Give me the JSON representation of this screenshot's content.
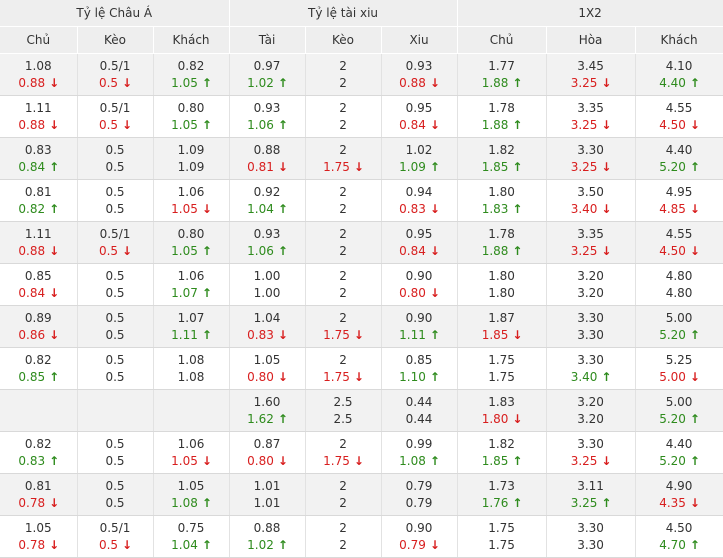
{
  "groups": [
    "Tỷ lệ Châu Á",
    "Tỷ lệ tài xiu",
    "1X2"
  ],
  "columns": [
    "Chủ",
    "Kèo",
    "Khách",
    "Tài",
    "Kèo",
    "Xiu",
    "Chủ",
    "Hòa",
    "Khách"
  ],
  "icons": {
    "up": "arrow-up-icon",
    "down": "arrow-down-icon"
  },
  "colors": {
    "up": "#2e8b1d",
    "down": "#d81e1e",
    "header_bg": "#eeeeee",
    "alt_row_bg": "#f2f2f2"
  },
  "arrow_glyphs": {
    "up": "↑",
    "down": "↓"
  },
  "rows": [
    [
      [
        {
          "v": "1.08"
        },
        {
          "v": "0.88",
          "t": "down"
        }
      ],
      [
        {
          "v": "0.5/1"
        },
        {
          "v": "0.5",
          "t": "down"
        }
      ],
      [
        {
          "v": "0.82"
        },
        {
          "v": "1.05",
          "t": "up"
        }
      ],
      [
        {
          "v": "0.97"
        },
        {
          "v": "1.02",
          "t": "up"
        }
      ],
      [
        {
          "v": "2"
        },
        {
          "v": "2"
        }
      ],
      [
        {
          "v": "0.93"
        },
        {
          "v": "0.88",
          "t": "down"
        }
      ],
      [
        {
          "v": "1.77"
        },
        {
          "v": "1.88",
          "t": "up"
        }
      ],
      [
        {
          "v": "3.45"
        },
        {
          "v": "3.25",
          "t": "down"
        }
      ],
      [
        {
          "v": "4.10"
        },
        {
          "v": "4.40",
          "t": "up"
        }
      ]
    ],
    [
      [
        {
          "v": "1.11"
        },
        {
          "v": "0.88",
          "t": "down"
        }
      ],
      [
        {
          "v": "0.5/1"
        },
        {
          "v": "0.5",
          "t": "down"
        }
      ],
      [
        {
          "v": "0.80"
        },
        {
          "v": "1.05",
          "t": "up"
        }
      ],
      [
        {
          "v": "0.93"
        },
        {
          "v": "1.06",
          "t": "up"
        }
      ],
      [
        {
          "v": "2"
        },
        {
          "v": "2"
        }
      ],
      [
        {
          "v": "0.95"
        },
        {
          "v": "0.84",
          "t": "down"
        }
      ],
      [
        {
          "v": "1.78"
        },
        {
          "v": "1.88",
          "t": "up"
        }
      ],
      [
        {
          "v": "3.35"
        },
        {
          "v": "3.25",
          "t": "down"
        }
      ],
      [
        {
          "v": "4.55"
        },
        {
          "v": "4.50",
          "t": "down"
        }
      ]
    ],
    [
      [
        {
          "v": "0.83"
        },
        {
          "v": "0.84",
          "t": "up"
        }
      ],
      [
        {
          "v": "0.5"
        },
        {
          "v": "0.5"
        }
      ],
      [
        {
          "v": "1.09"
        },
        {
          "v": "1.09"
        }
      ],
      [
        {
          "v": "0.88"
        },
        {
          "v": "0.81",
          "t": "down"
        }
      ],
      [
        {
          "v": "2"
        },
        {
          "v": "1.75",
          "t": "down"
        }
      ],
      [
        {
          "v": "1.02"
        },
        {
          "v": "1.09",
          "t": "up"
        }
      ],
      [
        {
          "v": "1.82"
        },
        {
          "v": "1.85",
          "t": "up"
        }
      ],
      [
        {
          "v": "3.30"
        },
        {
          "v": "3.25",
          "t": "down"
        }
      ],
      [
        {
          "v": "4.40"
        },
        {
          "v": "5.20",
          "t": "up"
        }
      ]
    ],
    [
      [
        {
          "v": "0.81"
        },
        {
          "v": "0.82",
          "t": "up"
        }
      ],
      [
        {
          "v": "0.5"
        },
        {
          "v": "0.5"
        }
      ],
      [
        {
          "v": "1.06"
        },
        {
          "v": "1.05",
          "t": "down"
        }
      ],
      [
        {
          "v": "0.92"
        },
        {
          "v": "1.04",
          "t": "up"
        }
      ],
      [
        {
          "v": "2"
        },
        {
          "v": "2"
        }
      ],
      [
        {
          "v": "0.94"
        },
        {
          "v": "0.83",
          "t": "down"
        }
      ],
      [
        {
          "v": "1.80"
        },
        {
          "v": "1.83",
          "t": "up"
        }
      ],
      [
        {
          "v": "3.50"
        },
        {
          "v": "3.40",
          "t": "down"
        }
      ],
      [
        {
          "v": "4.95"
        },
        {
          "v": "4.85",
          "t": "down"
        }
      ]
    ],
    [
      [
        {
          "v": "1.11"
        },
        {
          "v": "0.88",
          "t": "down"
        }
      ],
      [
        {
          "v": "0.5/1"
        },
        {
          "v": "0.5",
          "t": "down"
        }
      ],
      [
        {
          "v": "0.80"
        },
        {
          "v": "1.05",
          "t": "up"
        }
      ],
      [
        {
          "v": "0.93"
        },
        {
          "v": "1.06",
          "t": "up"
        }
      ],
      [
        {
          "v": "2"
        },
        {
          "v": "2"
        }
      ],
      [
        {
          "v": "0.95"
        },
        {
          "v": "0.84",
          "t": "down"
        }
      ],
      [
        {
          "v": "1.78"
        },
        {
          "v": "1.88",
          "t": "up"
        }
      ],
      [
        {
          "v": "3.35"
        },
        {
          "v": "3.25",
          "t": "down"
        }
      ],
      [
        {
          "v": "4.55"
        },
        {
          "v": "4.50",
          "t": "down"
        }
      ]
    ],
    [
      [
        {
          "v": "0.85"
        },
        {
          "v": "0.84",
          "t": "down"
        }
      ],
      [
        {
          "v": "0.5"
        },
        {
          "v": "0.5"
        }
      ],
      [
        {
          "v": "1.06"
        },
        {
          "v": "1.07",
          "t": "up"
        }
      ],
      [
        {
          "v": "1.00"
        },
        {
          "v": "1.00"
        }
      ],
      [
        {
          "v": "2"
        },
        {
          "v": "2"
        }
      ],
      [
        {
          "v": "0.90"
        },
        {
          "v": "0.80",
          "t": "down"
        }
      ],
      [
        {
          "v": "1.80"
        },
        {
          "v": "1.80"
        }
      ],
      [
        {
          "v": "3.20"
        },
        {
          "v": "3.20"
        }
      ],
      [
        {
          "v": "4.80"
        },
        {
          "v": "4.80"
        }
      ]
    ],
    [
      [
        {
          "v": "0.89"
        },
        {
          "v": "0.86",
          "t": "down"
        }
      ],
      [
        {
          "v": "0.5"
        },
        {
          "v": "0.5"
        }
      ],
      [
        {
          "v": "1.07"
        },
        {
          "v": "1.11",
          "t": "up"
        }
      ],
      [
        {
          "v": "1.04"
        },
        {
          "v": "0.83",
          "t": "down"
        }
      ],
      [
        {
          "v": "2"
        },
        {
          "v": "1.75",
          "t": "down"
        }
      ],
      [
        {
          "v": "0.90"
        },
        {
          "v": "1.11",
          "t": "up"
        }
      ],
      [
        {
          "v": "1.87"
        },
        {
          "v": "1.85",
          "t": "down"
        }
      ],
      [
        {
          "v": "3.30"
        },
        {
          "v": "3.30"
        }
      ],
      [
        {
          "v": "5.00"
        },
        {
          "v": "5.20",
          "t": "up"
        }
      ]
    ],
    [
      [
        {
          "v": "0.82"
        },
        {
          "v": "0.85",
          "t": "up"
        }
      ],
      [
        {
          "v": "0.5"
        },
        {
          "v": "0.5"
        }
      ],
      [
        {
          "v": "1.08"
        },
        {
          "v": "1.08"
        }
      ],
      [
        {
          "v": "1.05"
        },
        {
          "v": "0.80",
          "t": "down"
        }
      ],
      [
        {
          "v": "2"
        },
        {
          "v": "1.75",
          "t": "down"
        }
      ],
      [
        {
          "v": "0.85"
        },
        {
          "v": "1.10",
          "t": "up"
        }
      ],
      [
        {
          "v": "1.75"
        },
        {
          "v": "1.75"
        }
      ],
      [
        {
          "v": "3.30"
        },
        {
          "v": "3.40",
          "t": "up"
        }
      ],
      [
        {
          "v": "5.25"
        },
        {
          "v": "5.00",
          "t": "down"
        }
      ]
    ],
    [
      [],
      [],
      [],
      [
        {
          "v": "1.60"
        },
        {
          "v": "1.62",
          "t": "up"
        }
      ],
      [
        {
          "v": "2.5"
        },
        {
          "v": "2.5"
        }
      ],
      [
        {
          "v": "0.44"
        },
        {
          "v": "0.44"
        }
      ],
      [
        {
          "v": "1.83"
        },
        {
          "v": "1.80",
          "t": "down"
        }
      ],
      [
        {
          "v": "3.20"
        },
        {
          "v": "3.20"
        }
      ],
      [
        {
          "v": "5.00"
        },
        {
          "v": "5.20",
          "t": "up"
        }
      ]
    ],
    [
      [
        {
          "v": "0.82"
        },
        {
          "v": "0.83",
          "t": "up"
        }
      ],
      [
        {
          "v": "0.5"
        },
        {
          "v": "0.5"
        }
      ],
      [
        {
          "v": "1.06"
        },
        {
          "v": "1.05",
          "t": "down"
        }
      ],
      [
        {
          "v": "0.87"
        },
        {
          "v": "0.80",
          "t": "down"
        }
      ],
      [
        {
          "v": "2"
        },
        {
          "v": "1.75",
          "t": "down"
        }
      ],
      [
        {
          "v": "0.99"
        },
        {
          "v": "1.08",
          "t": "up"
        }
      ],
      [
        {
          "v": "1.82"
        },
        {
          "v": "1.85",
          "t": "up"
        }
      ],
      [
        {
          "v": "3.30"
        },
        {
          "v": "3.25",
          "t": "down"
        }
      ],
      [
        {
          "v": "4.40"
        },
        {
          "v": "5.20",
          "t": "up"
        }
      ]
    ],
    [
      [
        {
          "v": "0.81"
        },
        {
          "v": "0.78",
          "t": "down"
        }
      ],
      [
        {
          "v": "0.5"
        },
        {
          "v": "0.5"
        }
      ],
      [
        {
          "v": "1.05"
        },
        {
          "v": "1.08",
          "t": "up"
        }
      ],
      [
        {
          "v": "1.01"
        },
        {
          "v": "1.01"
        }
      ],
      [
        {
          "v": "2"
        },
        {
          "v": "2"
        }
      ],
      [
        {
          "v": "0.79"
        },
        {
          "v": "0.79"
        }
      ],
      [
        {
          "v": "1.73"
        },
        {
          "v": "1.76",
          "t": "up"
        }
      ],
      [
        {
          "v": "3.11"
        },
        {
          "v": "3.25",
          "t": "up"
        }
      ],
      [
        {
          "v": "4.90"
        },
        {
          "v": "4.35",
          "t": "down"
        }
      ]
    ],
    [
      [
        {
          "v": "1.05"
        },
        {
          "v": "0.78",
          "t": "down"
        }
      ],
      [
        {
          "v": "0.5/1"
        },
        {
          "v": "0.5",
          "t": "down"
        }
      ],
      [
        {
          "v": "0.75"
        },
        {
          "v": "1.04",
          "t": "up"
        }
      ],
      [
        {
          "v": "0.88"
        },
        {
          "v": "1.02",
          "t": "up"
        }
      ],
      [
        {
          "v": "2"
        },
        {
          "v": "2"
        }
      ],
      [
        {
          "v": "0.90"
        },
        {
          "v": "0.79",
          "t": "down"
        }
      ],
      [
        {
          "v": "1.75"
        },
        {
          "v": "1.75"
        }
      ],
      [
        {
          "v": "3.30"
        },
        {
          "v": "3.30"
        }
      ],
      [
        {
          "v": "4.50"
        },
        {
          "v": "4.70",
          "t": "up"
        }
      ]
    ]
  ]
}
